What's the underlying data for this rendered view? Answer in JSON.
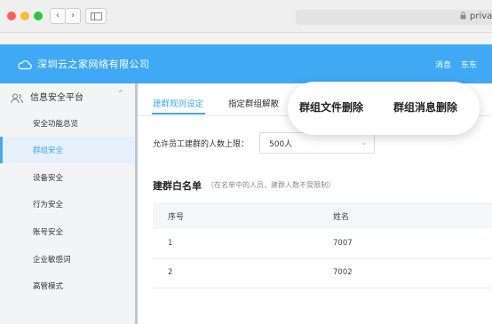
{
  "browser": {
    "url": "priva",
    "back_glyph": "‹",
    "forward_glyph": "›",
    "lock_glyph": "🔒"
  },
  "header": {
    "company": "深圳云之家网络有限公司",
    "messages": "消息",
    "user": "东东",
    "color": "#3fa9f5"
  },
  "sidebar": {
    "group": {
      "label": "信息安全平台",
      "icon": "user-group-icon",
      "chevron": "⌃"
    },
    "items": [
      {
        "label": "安全功能总览"
      },
      {
        "label": "群组安全"
      },
      {
        "label": "设备安全"
      },
      {
        "label": "行为安全"
      },
      {
        "label": "账号安全"
      },
      {
        "label": "企业敏感词"
      },
      {
        "label": "高管模式"
      }
    ],
    "active_index": 1
  },
  "tabs": [
    {
      "label": "建群规则设定"
    },
    {
      "label": "指定群组解散"
    },
    {
      "label": "群组文件删除"
    },
    {
      "label": "群组消息删除"
    }
  ],
  "form": {
    "limit_label": "允许员工建群的人数上限：",
    "limit_value": "500人",
    "chevron": "⌄"
  },
  "whitelist": {
    "title": "建群白名单",
    "hint": "（在名单中的人员，建群人数不受限制）",
    "columns": [
      "序号",
      "姓名"
    ],
    "rows": [
      [
        "1",
        "7007"
      ],
      [
        "2",
        "7002"
      ]
    ]
  }
}
